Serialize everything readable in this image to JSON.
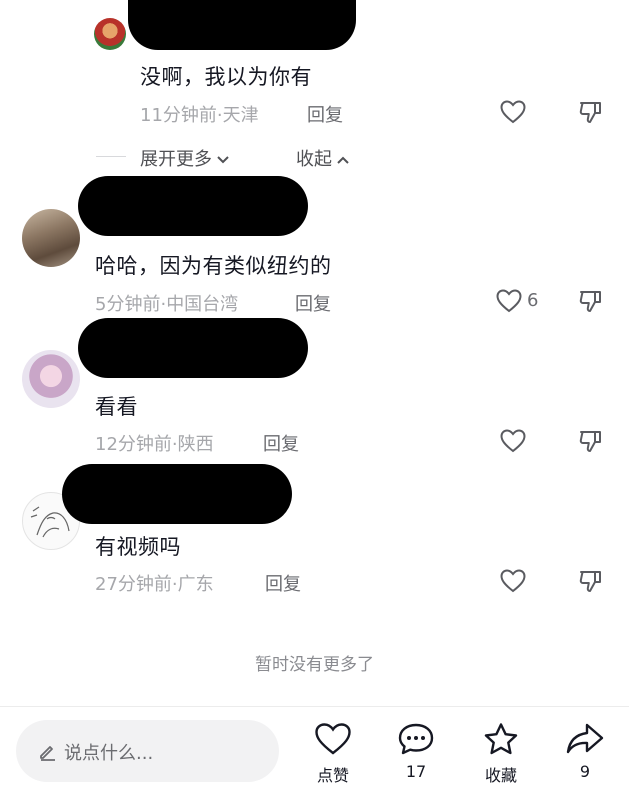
{
  "comments": [
    {
      "text": "没啊，我以为你有",
      "time": "11分钟前",
      "location": "天津",
      "reply_label": "回复",
      "likes": ""
    },
    {
      "text": "哈哈，因为有类似纽约的",
      "time": "5分钟前",
      "location": "中国台湾",
      "reply_label": "回复",
      "likes": "6"
    },
    {
      "text": "看看",
      "time": "12分钟前",
      "location": "陕西",
      "reply_label": "回复",
      "likes": ""
    },
    {
      "text": "有视频吗",
      "time": "27分钟前",
      "location": "广东",
      "reply_label": "回复",
      "likes": ""
    }
  ],
  "thread": {
    "expand_label": "展开更多",
    "collapse_label": "收起"
  },
  "end_text": "暂时没有更多了",
  "bottom_bar": {
    "input_placeholder": "说点什么...",
    "like_label": "点赞",
    "comment_count": "17",
    "favorite_label": "收藏",
    "share_count": "9"
  },
  "icons": {
    "like": "heart-icon",
    "dislike": "thumbs-down-icon",
    "comment": "chat-bubble-icon",
    "favorite": "star-icon",
    "share": "share-arrow-icon",
    "edit": "pencil-icon"
  }
}
